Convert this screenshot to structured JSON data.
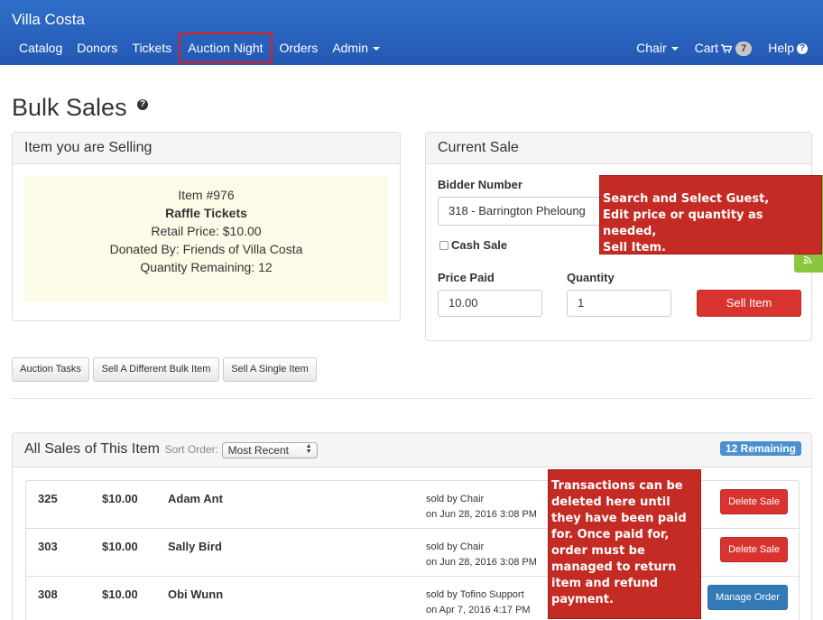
{
  "navbar": {
    "brand": "Villa Costa",
    "items": [
      {
        "label": "Catalog"
      },
      {
        "label": "Donors"
      },
      {
        "label": "Tickets"
      },
      {
        "label": "Auction Night"
      },
      {
        "label": "Orders"
      },
      {
        "label": "Admin"
      }
    ],
    "right": {
      "chair": "Chair",
      "cart": "Cart",
      "cart_count": "7",
      "help": "Help"
    }
  },
  "page": {
    "title": "Bulk Sales",
    "help_glyph": "?"
  },
  "selling": {
    "heading": "Item you are Selling",
    "item_number": "Item #976",
    "item_name": "Raffle Tickets",
    "retail_price": "Retail Price: $10.00",
    "donated_by": "Donated By: Friends of Villa Costa",
    "quantity_remaining": "Quantity Remaining: 12"
  },
  "current_sale": {
    "heading": "Current Sale",
    "bidder_label": "Bidder Number",
    "bidder_value": "318 -  Barrington Pheloung",
    "cash_sale_label": "Cash Sale",
    "price_label": "Price Paid",
    "price_value": "10.00",
    "quantity_label": "Quantity",
    "quantity_value": "1",
    "sell_button": "Sell Item"
  },
  "buttons": {
    "auction_tasks": "Auction Tasks",
    "sell_bulk": "Sell A Different Bulk Item",
    "sell_single": "Sell A Single Item"
  },
  "sales": {
    "heading": "All Sales of This Item",
    "sort_label": "Sort Order:",
    "sort_value": "Most Recent",
    "remaining": "12 Remaining",
    "rows": [
      {
        "bidder": "325",
        "amount": "$10.00",
        "name": "Adam Ant",
        "sold_by": "sold by Chair",
        "date": "on Jun 28, 2016 3:08 PM",
        "action": "Delete Sale"
      },
      {
        "bidder": "303",
        "amount": "$10.00",
        "name": "Sally Bird",
        "sold_by": "sold by Chair",
        "date": "on Jun 28, 2016 3:08 PM",
        "action": "Delete Sale"
      },
      {
        "bidder": "308",
        "amount": "$10.00",
        "name": "Obi Wunn",
        "sold_by": "sold by Tofino Support",
        "date": "on Apr 7, 2016 4:17 PM",
        "action": "Manage Order"
      }
    ]
  },
  "annotations": {
    "callout_1": "Search and Select Guest,\nEdit price or quantity as needed,\nSell Item.",
    "callout_2": "Transactions can be deleted here until they have been paid for.   Once paid for, order must be managed to return item and refund payment."
  },
  "colors": {
    "navbar": "#2458b3",
    "danger": "#d9332f",
    "primary": "#337ab7",
    "highlight_border": "#e01e1e",
    "callout": "#c42b25",
    "item_box": "#fdfbe8"
  }
}
